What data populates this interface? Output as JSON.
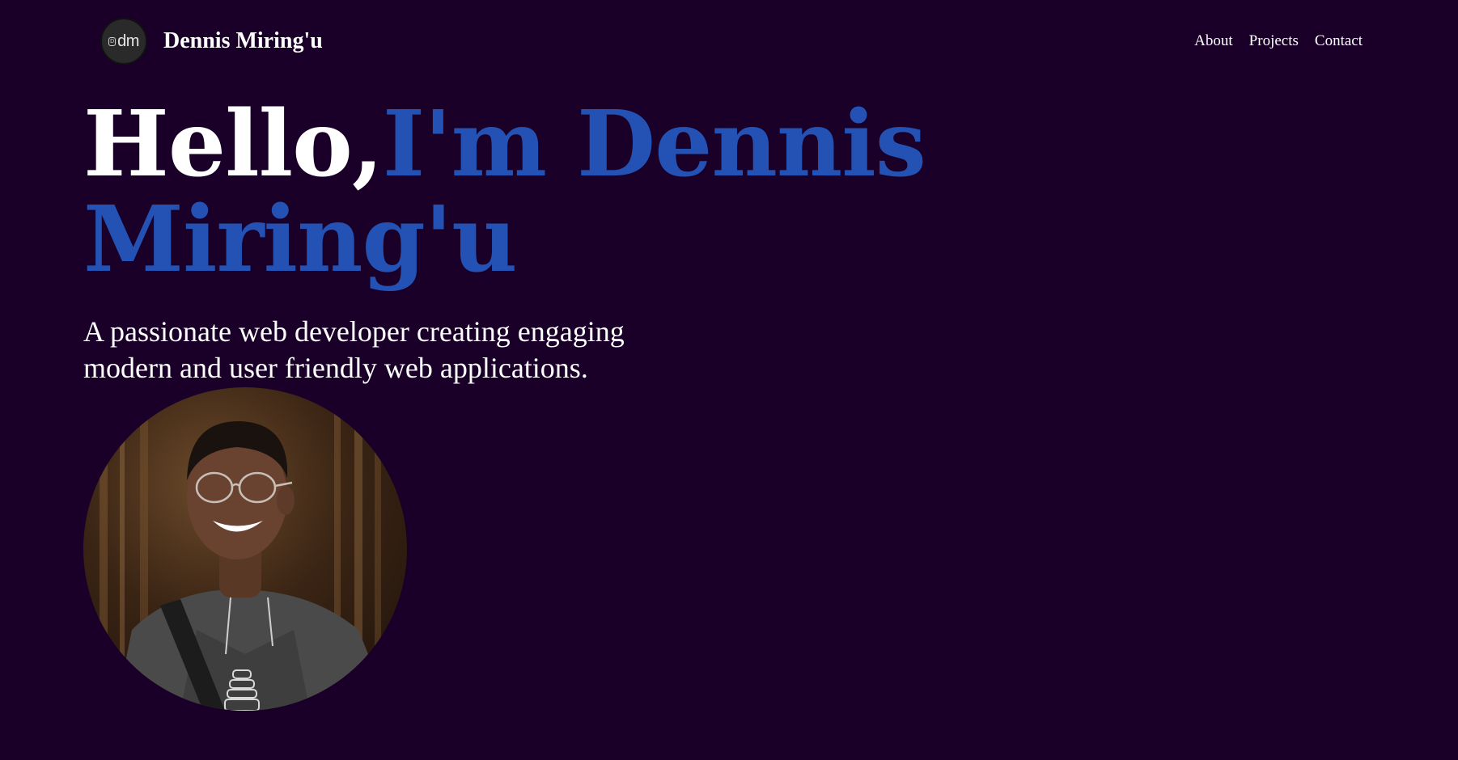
{
  "header": {
    "logo_text": "dm",
    "logo_mark": "D",
    "brand_name": "Dennis Miring'u",
    "nav": [
      {
        "label": "About"
      },
      {
        "label": "Projects"
      },
      {
        "label": "Contact"
      }
    ]
  },
  "hero": {
    "greeting": "Hello,",
    "name": "I'm Dennis Miring'u",
    "subtitle": "A passionate web developer creating engaging modern and user friendly web applications."
  },
  "colors": {
    "background": "#1a0028",
    "accent": "#2352b4",
    "text": "#ffffff"
  }
}
